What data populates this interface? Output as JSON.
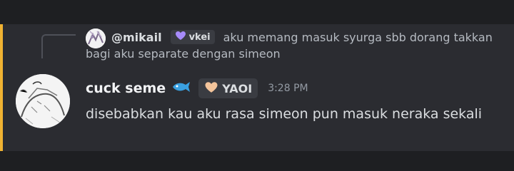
{
  "reply": {
    "username": "@mikail",
    "tag": {
      "label": "vkei",
      "icon": "purple-heart-icon",
      "color": "#a78bfa"
    },
    "text_line1": "aku memang masuk syurga sbb dorang takkan",
    "text_line2": "bagi aku separate dengan simeon"
  },
  "message": {
    "author": "cuck seme",
    "author_icon": "fish-icon",
    "role_tag": {
      "label": "YAOI",
      "icon": "peach-heart-icon",
      "color": "#f4c49b"
    },
    "timestamp": "3:28 PM",
    "content": "disebabkan kau aku rasa simeon pun masuk neraka sekali"
  },
  "colors": {
    "highlight": "#f0b232",
    "message_bg": "#2b2c31",
    "page_bg": "#1e1f22"
  }
}
